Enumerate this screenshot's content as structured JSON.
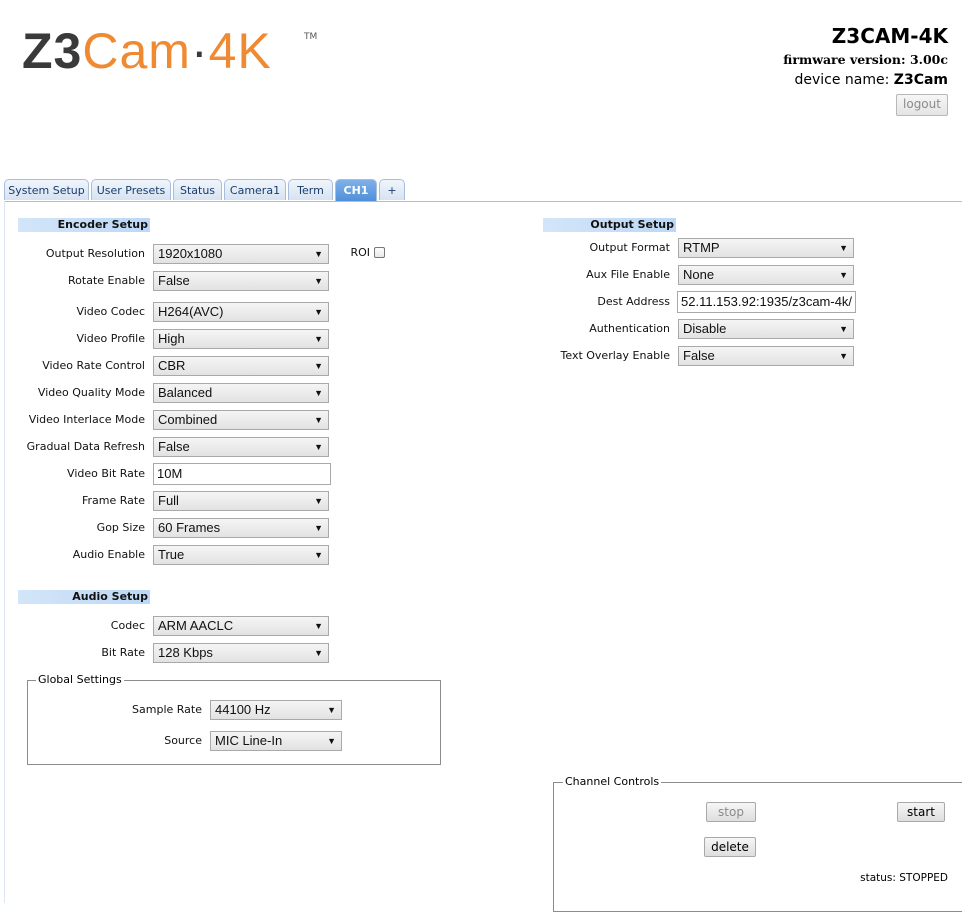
{
  "logo": {
    "part1": "Z3",
    "part2": "Cam",
    "dot": "·",
    "part3": "4K",
    "tm": "TM"
  },
  "header": {
    "title": "Z3CAM-4K",
    "firmware_label": "firmware version:",
    "firmware_value": "3.00c",
    "device_label": "device name:",
    "device_value": "Z3Cam",
    "logout_label": "logout"
  },
  "tabs": [
    {
      "label": "System Setup"
    },
    {
      "label": "User Presets"
    },
    {
      "label": "Status"
    },
    {
      "label": "Camera1"
    },
    {
      "label": "Term"
    },
    {
      "label": "CH1",
      "active": true
    },
    {
      "label": "+"
    }
  ],
  "encoder": {
    "heading": "Encoder Setup",
    "roi_label": "ROI",
    "fields": [
      {
        "label": "Output Resolution",
        "value": "1920x1080"
      },
      {
        "label": "Rotate Enable",
        "value": "False"
      },
      {
        "label": "Video Codec",
        "value": "H264(AVC)"
      },
      {
        "label": "Video Profile",
        "value": "High"
      },
      {
        "label": "Video Rate Control",
        "value": "CBR"
      },
      {
        "label": "Video Quality Mode",
        "value": "Balanced"
      },
      {
        "label": "Video Interlace Mode",
        "value": "Combined"
      },
      {
        "label": "Gradual Data Refresh",
        "value": "False"
      },
      {
        "label": "Video Bit Rate",
        "value": "10M"
      },
      {
        "label": "Frame Rate",
        "value": "Full"
      },
      {
        "label": "Gop Size",
        "value": "60 Frames"
      },
      {
        "label": "Audio Enable",
        "value": "True"
      }
    ]
  },
  "audio": {
    "heading": "Audio Setup",
    "fields": [
      {
        "label": "Codec",
        "value": "ARM AACLC"
      },
      {
        "label": "Bit Rate",
        "value": "128 Kbps"
      }
    ],
    "global_legend": "Global Settings",
    "global_fields": [
      {
        "label": "Sample Rate",
        "value": "44100 Hz"
      },
      {
        "label": "Source",
        "value": "MIC Line-In"
      }
    ]
  },
  "output": {
    "heading": "Output Setup",
    "fields": [
      {
        "label": "Output Format",
        "value": "RTMP"
      },
      {
        "label": "Aux File Enable",
        "value": "None"
      },
      {
        "label": "Dest Address",
        "value": "52.11.153.92:1935/z3cam-4k/"
      },
      {
        "label": "Authentication",
        "value": "Disable"
      },
      {
        "label": "Text Overlay Enable",
        "value": "False"
      }
    ]
  },
  "channel": {
    "legend": "Channel Controls",
    "stop_label": "stop",
    "start_label": "start",
    "delete_label": "delete",
    "status_text": "status: STOPPED"
  }
}
